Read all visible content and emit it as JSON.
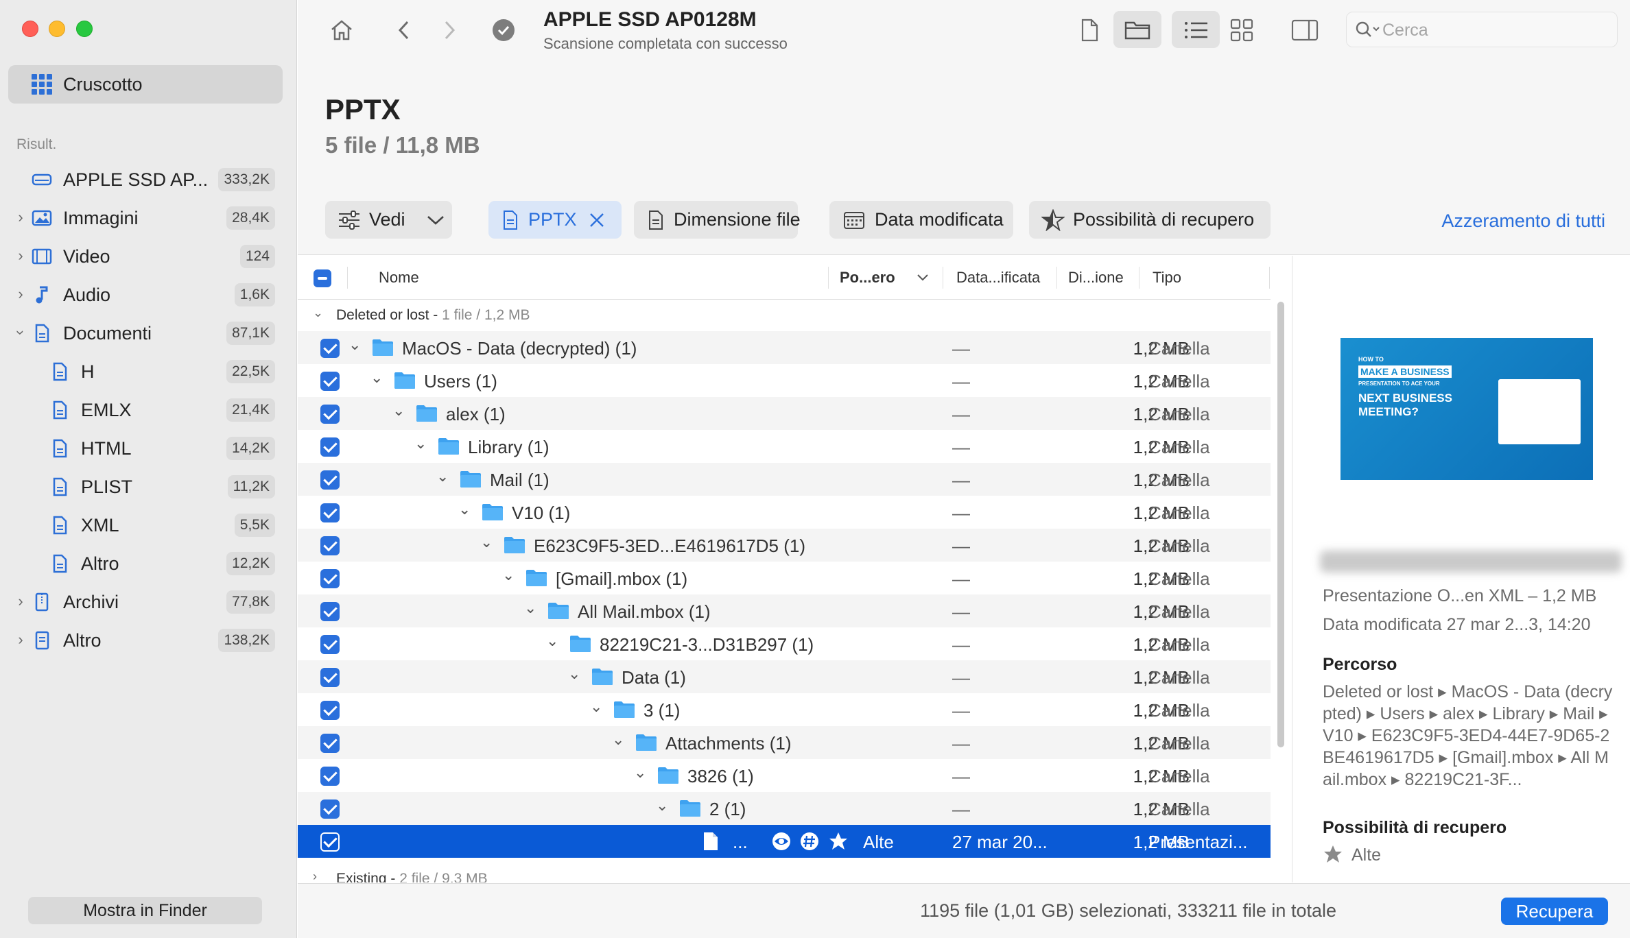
{
  "sidebar": {
    "dashboard_label": "Cruscotto",
    "section_label": "Risult.",
    "items": [
      {
        "label": "APPLE SSD AP...",
        "count": "333,2K",
        "icon": "drive-icon"
      },
      {
        "label": "Immagini",
        "count": "28,4K",
        "icon": "image-icon"
      },
      {
        "label": "Video",
        "count": "124",
        "icon": "film-icon"
      },
      {
        "label": "Audio",
        "count": "1,6K",
        "icon": "music-note-icon"
      },
      {
        "label": "Documenti",
        "count": "87,1K",
        "icon": "document-icon"
      },
      {
        "label": "H",
        "count": "22,5K",
        "icon": "document-icon"
      },
      {
        "label": "EMLX",
        "count": "21,4K",
        "icon": "document-icon"
      },
      {
        "label": "HTML",
        "count": "14,2K",
        "icon": "document-icon"
      },
      {
        "label": "PLIST",
        "count": "11,2K",
        "icon": "document-icon"
      },
      {
        "label": "XML",
        "count": "5,5K",
        "icon": "document-icon"
      },
      {
        "label": "Altro",
        "count": "12,2K",
        "icon": "document-icon"
      },
      {
        "label": "Archivi",
        "count": "77,8K",
        "icon": "archive-icon"
      },
      {
        "label": "Altro",
        "count": "138,2K",
        "icon": "document-icon"
      }
    ],
    "finder_button": "Mostra in Finder"
  },
  "toolbar": {
    "title": "APPLE SSD AP0128M",
    "subtitle": "Scansione completata con successo",
    "search_placeholder": "Cerca"
  },
  "heading": {
    "title": "PPTX",
    "subtitle": "5 file / 11,8 MB"
  },
  "filters": {
    "view_label": "Vedi",
    "pptx_label": "PPTX",
    "size_label": "Dimensione file",
    "date_label": "Data modificata",
    "recovery_label": "Possibilità di recupero",
    "reset_label": "Azzeramento di tutti"
  },
  "table": {
    "columns": {
      "name": "Nome",
      "recovery": "Po...ero",
      "date": "Data...ificata",
      "size": "Di...ione",
      "type": "Tipo"
    },
    "group_deleted": {
      "label": "Deleted or lost - ",
      "meta": "1 file / 1,2 MB"
    },
    "group_existing": {
      "label": "Existing - ",
      "meta": "2 file / 9,3 MB"
    },
    "rows": [
      {
        "name": "MacOS - Data (decrypted) (1)",
        "date": "—",
        "size": "1,2 MB",
        "type": "Cartella"
      },
      {
        "name": "Users (1)",
        "date": "—",
        "size": "1,2 MB",
        "type": "Cartella"
      },
      {
        "name": "alex (1)",
        "date": "—",
        "size": "1,2 MB",
        "type": "Cartella"
      },
      {
        "name": "Library (1)",
        "date": "—",
        "size": "1,2 MB",
        "type": "Cartella"
      },
      {
        "name": "Mail (1)",
        "date": "—",
        "size": "1,2 MB",
        "type": "Cartella"
      },
      {
        "name": "V10 (1)",
        "date": "—",
        "size": "1,2 MB",
        "type": "Cartella"
      },
      {
        "name": "E623C9F5-3ED...E4619617D5 (1)",
        "date": "—",
        "size": "1,2 MB",
        "type": "Cartella"
      },
      {
        "name": "[Gmail].mbox (1)",
        "date": "—",
        "size": "1,2 MB",
        "type": "Cartella"
      },
      {
        "name": "All Mail.mbox (1)",
        "date": "—",
        "size": "1,2 MB",
        "type": "Cartella"
      },
      {
        "name": "82219C21-3...D31B297 (1)",
        "date": "—",
        "size": "1,2 MB",
        "type": "Cartella"
      },
      {
        "name": "Data (1)",
        "date": "—",
        "size": "1,2 MB",
        "type": "Cartella"
      },
      {
        "name": "3 (1)",
        "date": "—",
        "size": "1,2 MB",
        "type": "Cartella"
      },
      {
        "name": "Attachments (1)",
        "date": "—",
        "size": "1,2 MB",
        "type": "Cartella"
      },
      {
        "name": "3826 (1)",
        "date": "—",
        "size": "1,2 MB",
        "type": "Cartella"
      },
      {
        "name": "2 (1)",
        "date": "—",
        "size": "1,2 MB",
        "type": "Cartella"
      }
    ],
    "selected_row": {
      "name": "...",
      "recovery": "Alte",
      "date": "27 mar 20...",
      "size": "1,2 MB",
      "type": "Presentazi..."
    }
  },
  "panel": {
    "thumb": {
      "line1": "HOW TO",
      "line2": "MAKE A BUSINESS",
      "line3": "PRESENTATION TO ACE YOUR",
      "line4": "NEXT BUSINESS MEETING?"
    },
    "info1": "Presentazione O...en XML – 1,2 MB",
    "info2": "Data modificata  27 mar 2...3, 14:20",
    "path_label": "Percorso",
    "path": "Deleted or lost ▸ MacOS - Data (decrypted) ▸ Users ▸ alex ▸ Library ▸ Mail ▸ V10 ▸ E623C9F5-3ED4-44E7-9D65-2BE4619617D5 ▸ [Gmail].mbox ▸ All Mail.mbox ▸ 82219C21-3F...",
    "recovery_label": "Possibilità di recupero",
    "recovery_value": "Alte"
  },
  "footer": {
    "status": "1195 file (1,01 GB) selezionati, 333211 file in totale",
    "recover_button": "Recupera"
  }
}
